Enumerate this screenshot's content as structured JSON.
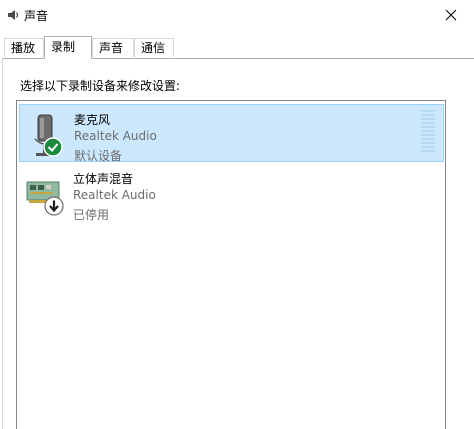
{
  "window": {
    "title": "声音"
  },
  "tabs": [
    {
      "label": "播放"
    },
    {
      "label": "录制"
    },
    {
      "label": "声音"
    },
    {
      "label": "通信"
    }
  ],
  "active_tab": "录制",
  "instruction": "选择以下录制设备来修改设置:",
  "devices": [
    {
      "name": "麦克风",
      "driver": "Realtek Audio",
      "status": "默认设备",
      "selected": true,
      "icon": "microphone-icon",
      "badge": "default-check-icon"
    },
    {
      "name": "立体声混音",
      "driver": "Realtek Audio",
      "status": "已停用",
      "selected": false,
      "icon": "sound-card-icon",
      "badge": "disabled-arrow-icon"
    }
  ],
  "colors": {
    "selection_bg": "#cce8ff",
    "selection_border": "#99d1ff",
    "check_green": "#1b8a3c",
    "meter": "#b7dcf2"
  }
}
